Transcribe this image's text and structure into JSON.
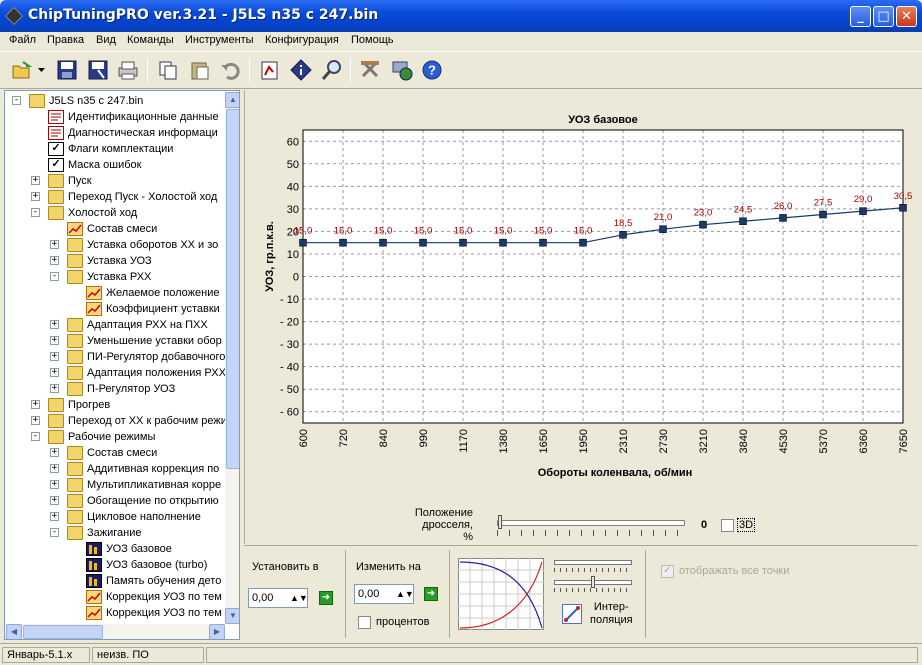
{
  "window": {
    "title": "ChipTuningPRO ver.3.21 - J5LS n35 с 247.bin"
  },
  "menu": [
    "Файл",
    "Правка",
    "Вид",
    "Команды",
    "Инструменты",
    "Конфигурация",
    "Помощь"
  ],
  "toolbar": {
    "icons": [
      "open-icon",
      "save-icon",
      "save-as-icon",
      "print-icon",
      "copy-icon",
      "paste-icon",
      "undo-icon",
      "compare-icon",
      "info-icon",
      "search-icon",
      "tools-icon",
      "connect-icon",
      "help-icon"
    ]
  },
  "tree": {
    "items": [
      {
        "label": "J5LS n35 с 247.bin",
        "level": 0,
        "icon": "folder",
        "exp": "-"
      },
      {
        "label": "Идентификационные данные",
        "level": 1,
        "icon": "docred",
        "exp": ""
      },
      {
        "label": "Диагностическая информаци",
        "level": 1,
        "icon": "docred",
        "exp": ""
      },
      {
        "label": "Флаги комплектации",
        "level": 1,
        "icon": "chk",
        "exp": ""
      },
      {
        "label": "Маска ошибок",
        "level": 1,
        "icon": "chk",
        "exp": ""
      },
      {
        "label": "Пуск",
        "level": 1,
        "icon": "folder",
        "exp": "+"
      },
      {
        "label": "Переход Пуск - Холостой ход",
        "level": 1,
        "icon": "folder",
        "exp": "+"
      },
      {
        "label": "Холостой ход",
        "level": 1,
        "icon": "folder",
        "exp": "-"
      },
      {
        "label": "Состав смеси",
        "level": 2,
        "icon": "graphic",
        "exp": ""
      },
      {
        "label": "Уставка оборотов ХХ и зо",
        "level": 2,
        "icon": "folder",
        "exp": "+"
      },
      {
        "label": "Уставка УОЗ",
        "level": 2,
        "icon": "folder",
        "exp": "+"
      },
      {
        "label": "Уставка РХХ",
        "level": 2,
        "icon": "folder",
        "exp": "-"
      },
      {
        "label": "Желаемое положение",
        "level": 3,
        "icon": "graphic",
        "exp": ""
      },
      {
        "label": "Коэффициент уставки",
        "level": 3,
        "icon": "graphic",
        "exp": ""
      },
      {
        "label": "Адаптация РХХ на ПХХ",
        "level": 2,
        "icon": "folder",
        "exp": "+"
      },
      {
        "label": "Уменьшение уставки обор",
        "level": 2,
        "icon": "folder",
        "exp": "+"
      },
      {
        "label": "ПИ-Регулятор добавочного",
        "level": 2,
        "icon": "folder",
        "exp": "+"
      },
      {
        "label": "Адаптация положения РХХ",
        "level": 2,
        "icon": "folder",
        "exp": "+"
      },
      {
        "label": "П-Регулятор УОЗ",
        "level": 2,
        "icon": "folder",
        "exp": "+"
      },
      {
        "label": "Прогрев",
        "level": 1,
        "icon": "folder",
        "exp": "+"
      },
      {
        "label": "Переход от ХХ к рабочим режи",
        "level": 1,
        "icon": "folder",
        "exp": "+"
      },
      {
        "label": "Рабочие режимы",
        "level": 1,
        "icon": "folder",
        "exp": "-"
      },
      {
        "label": "Состав смеси",
        "level": 2,
        "icon": "folder",
        "exp": "+"
      },
      {
        "label": "Аддитивная коррекция по",
        "level": 2,
        "icon": "folder",
        "exp": "+"
      },
      {
        "label": "Мультипликативная корре",
        "level": 2,
        "icon": "folder",
        "exp": "+"
      },
      {
        "label": "Обогащение по открытию",
        "level": 2,
        "icon": "folder",
        "exp": "+"
      },
      {
        "label": "Цикловое наполнение",
        "level": 2,
        "icon": "folder",
        "exp": "+"
      },
      {
        "label": "Зажигание",
        "level": 2,
        "icon": "folder",
        "exp": "-"
      },
      {
        "label": "УОЗ базовое",
        "level": 3,
        "icon": "bars",
        "exp": ""
      },
      {
        "label": "УОЗ базовое (turbo)",
        "level": 3,
        "icon": "bars",
        "exp": ""
      },
      {
        "label": "Память обучения дето",
        "level": 3,
        "icon": "bars",
        "exp": ""
      },
      {
        "label": "Коррекция УОЗ по тем",
        "level": 3,
        "icon": "graphic",
        "exp": ""
      },
      {
        "label": "Коррекция УОЗ по тем",
        "level": 3,
        "icon": "graphic",
        "exp": ""
      }
    ]
  },
  "chart_data": {
    "type": "line",
    "title": "УОЗ базовое",
    "xlabel": "Обороты коленвала, об/мин",
    "ylabel": "УОЗ, гр.п.к.в.",
    "categories": [
      "600",
      "720",
      "840",
      "990",
      "1170",
      "1380",
      "1650",
      "1950",
      "2310",
      "2730",
      "3210",
      "3840",
      "4530",
      "5370",
      "6360",
      "7650"
    ],
    "values": [
      15.0,
      15.0,
      15.0,
      15.0,
      15.0,
      15.0,
      15.0,
      15.0,
      18.5,
      21.0,
      23.0,
      24.5,
      26.0,
      27.5,
      29.0,
      30.5
    ],
    "value_labels": [
      "15,0",
      "15,0",
      "15,0",
      "15,0",
      "15,0",
      "15,0",
      "15,0",
      "15,0",
      "18,5",
      "21,0",
      "23,0",
      "24,5",
      "26,0",
      "27,5",
      "29,0",
      "30,5"
    ],
    "yticks": [
      "60",
      "50",
      "40",
      "30",
      "20",
      "10",
      "0",
      "- 10",
      "- 20",
      "- 30",
      "- 40",
      "- 50",
      "- 60"
    ],
    "ylim": [
      -65,
      65
    ],
    "grid": true,
    "line_color": "#1a3a6a",
    "label_color": "#a00000"
  },
  "throttle": {
    "label_line1": "Положение дросселя,",
    "label_line2": "%",
    "value": "0",
    "value_fraction": 0.0,
    "checkbox_3d": "3D"
  },
  "bottom": {
    "set_label": "Установить в",
    "set_value": "0,00",
    "change_label": "Изменить на",
    "change_value": "0,00",
    "percent_label": "процентов",
    "interp_label_1": "Интер-",
    "interp_label_2": "поляция",
    "show_all_points": "отображать все точки"
  },
  "status": {
    "cell1": "Январь-5.1.x",
    "cell2": "неизв. ПО"
  }
}
